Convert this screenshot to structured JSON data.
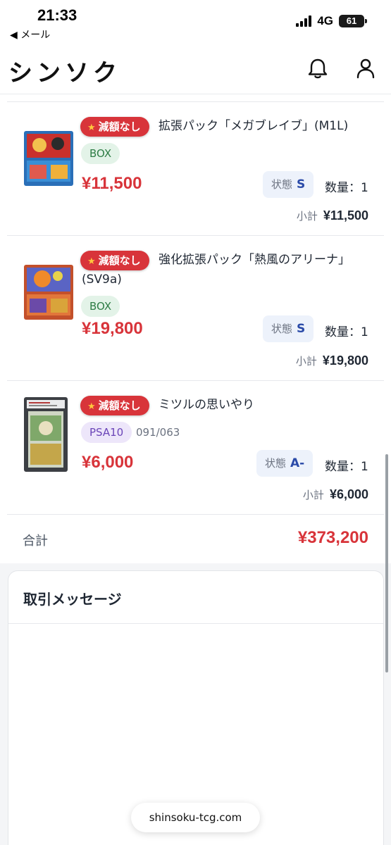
{
  "status_bar": {
    "time": "21:33",
    "back_label": "◀ メール",
    "network": "4G",
    "battery": "61"
  },
  "header": {
    "logo": "シンソク",
    "bell_icon": "bell-icon",
    "user_icon": "user-icon"
  },
  "items": [
    {
      "badge": "減額なし",
      "title": "拡張パック「メガブレイブ」(M1L)",
      "tag": "BOX",
      "price": "¥11,500",
      "condition_label": "状態",
      "condition_value": "S",
      "quantity": "数量：1",
      "subtotal_label": "小計",
      "subtotal_value": "¥11,500"
    },
    {
      "badge": "減額なし",
      "title_line1": "強化拡張パック「熱風のアリーナ」",
      "title_line2": "(SV9a)",
      "tag": "BOX",
      "price": "¥19,800",
      "condition_label": "状態",
      "condition_value": "S",
      "quantity": "数量：1",
      "subtotal_label": "小計",
      "subtotal_value": "¥19,800"
    },
    {
      "badge": "減額なし",
      "title": "ミツルの思いやり",
      "tag": "PSA10",
      "card_number": "091/063",
      "price": "¥6,000",
      "condition_label": "状態",
      "condition_value": "A-",
      "quantity": "数量：1",
      "subtotal_label": "小計",
      "subtotal_value": "¥6,000"
    }
  ],
  "total": {
    "label": "合計",
    "value": "¥373,200"
  },
  "messages": {
    "title": "取引メッセージ"
  },
  "browser": {
    "url": "shinsoku-tcg.com"
  },
  "colors": {
    "accent_red": "#d8343a",
    "box_tag_green": "#2f7d46",
    "psa_tag_purple": "#6b45b8",
    "condition_blue": "#2a4aa8"
  }
}
